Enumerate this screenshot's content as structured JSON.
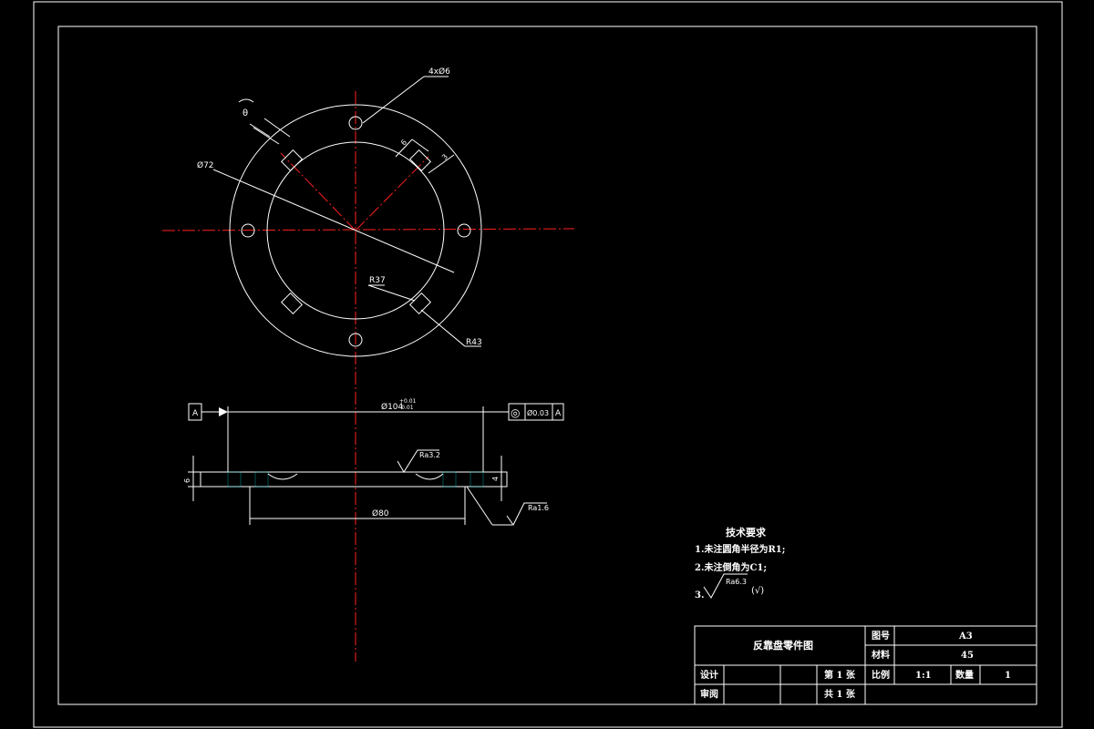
{
  "dims": {
    "slot_holes": "4xØ6",
    "angle": "θ",
    "d_inner": "Ø72",
    "r_inner": "R37",
    "r_outer": "R43",
    "slot_w": "6",
    "slot_d": "3",
    "outer_dia_main": "Ø104",
    "outer_dia_tol_top": "+0.01",
    "outer_dia_tol_bot": "-0.01",
    "d_80": "Ø80",
    "thickness": "6",
    "step": "4"
  },
  "datum": "A",
  "tolerance_frame": {
    "symbol": "◎",
    "value": "Ø0.03",
    "datum": "A"
  },
  "roughness": {
    "face": "Ra3.2",
    "side": "Ra1.6",
    "general": "Ra6.3"
  },
  "tech_requirements": {
    "title": "技术要求",
    "item1": "1.未注圆角半径为R1;",
    "item2": "2.未注倒角为C1;",
    "item3_num": "3.",
    "item3_suffix": "(√)"
  },
  "title_block": {
    "part_name": "反靠盘零件图",
    "drawing_no_label": "图号",
    "drawing_no": "A3",
    "material_label": "材料",
    "material": "45",
    "design_label": "设计",
    "review_label": "审阅",
    "sheet": "第 1 张",
    "total": "共 1 张",
    "scale_label": "比例",
    "scale": "1:1",
    "qty_label": "数量",
    "qty": "1"
  }
}
